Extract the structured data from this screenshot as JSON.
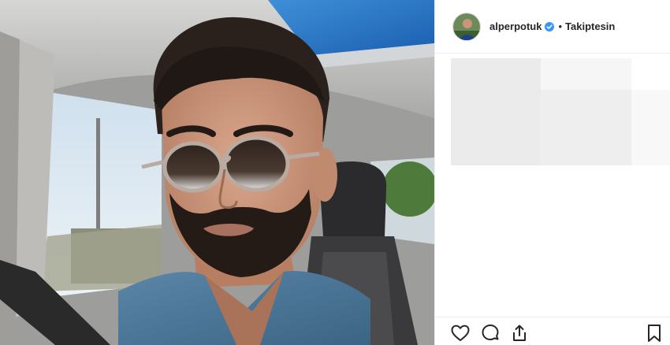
{
  "post": {
    "author": {
      "username": "alperpotuk",
      "verified": true,
      "separator": "•",
      "follow_status": "Takiptesin"
    },
    "photo": {
      "subject": "man wearing round sunglasses taking a selfie in a car"
    },
    "actions": {
      "icons": [
        "heart-icon",
        "comment-icon",
        "share-icon",
        "bookmark-icon"
      ]
    }
  },
  "colors": {
    "verified_badge": "#3897f0",
    "text": "#262626",
    "divider": "#efefef",
    "placeholder": "#ebebeb"
  }
}
